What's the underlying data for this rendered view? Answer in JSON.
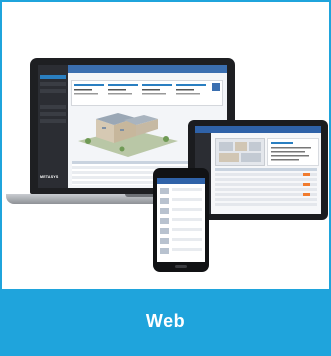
{
  "caption": {
    "label": "Web"
  },
  "laptop": {
    "brand_logo": "METASYS",
    "app_title": "",
    "nav_items": [
      "",
      "",
      "",
      "",
      "",
      ""
    ]
  },
  "colors": {
    "accent": "#1fa4dc",
    "app_header": "#3b6fb0",
    "sidebar": "#2b2d33",
    "alert": "#f07b2e"
  }
}
